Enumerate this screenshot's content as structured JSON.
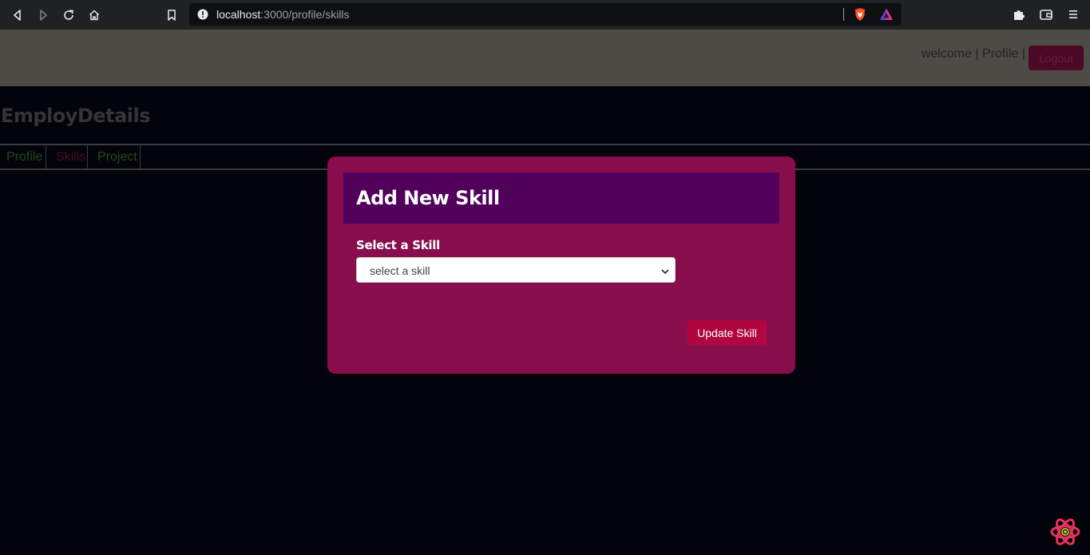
{
  "browser": {
    "url_host": "localhost",
    "url_path": ":3000/profile/skills"
  },
  "header": {
    "welcome": "welcome",
    "separator1": " | ",
    "profile_link": "Profile",
    "separator2": " |",
    "logout_label": "Logout"
  },
  "brand": "EmployDetails",
  "tabs": [
    {
      "label": "Profile"
    },
    {
      "label": "Skills"
    },
    {
      "label": "Project"
    }
  ],
  "modal": {
    "title": "Add New Skill",
    "field_label": "Select a Skill",
    "select_value": "select a skill",
    "submit_label": "Update Skill"
  },
  "colors": {
    "page_bg": "#02030b",
    "header_bg": "#4e4b47",
    "modal_bg": "#870d4d",
    "modal_header_bg": "#51005b",
    "button_bg": "#b1063f"
  },
  "icons": [
    "back-icon",
    "forward-icon",
    "reload-icon",
    "home-icon",
    "bookmark-icon",
    "info-icon",
    "brave-shield-icon",
    "brave-rewards-icon",
    "extensions-icon",
    "wallet-icon",
    "menu-icon",
    "react-devtools-icon"
  ]
}
